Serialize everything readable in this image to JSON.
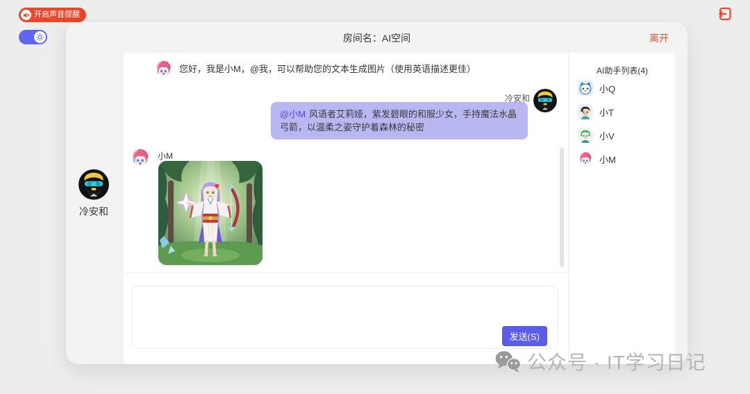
{
  "page": {
    "sound_alert_label": "开启声音提醒",
    "watermark_text": "公众号 · IT学习日记"
  },
  "header": {
    "room_label": "房间名：AI空间",
    "leave_label": "离开"
  },
  "chat": {
    "greeting": {
      "sender": "小M",
      "text": "您好，我是小M，@我，可以帮助您的文本生成图片（使用英语描述更佳）"
    },
    "user_message": {
      "sender": "冷安和",
      "mention": "@小M",
      "text": "风语者艾莉娅，紫发碧眼的和服少女，手持魔法水晶弓箭，以温柔之姿守护着森林的秘密"
    },
    "image_message": {
      "sender": "小M"
    }
  },
  "composer": {
    "input_value": "",
    "input_placeholder": "",
    "send_label": "发送(S)"
  },
  "user_panel": {
    "name": "冷安和"
  },
  "assistant_list": {
    "title": "AI助手列表(4)",
    "items": [
      {
        "name": "小Q"
      },
      {
        "name": "小T"
      },
      {
        "name": "小V"
      },
      {
        "name": "小M"
      }
    ]
  },
  "colors": {
    "accent_red": "#e8472c",
    "leave_red": "#e0512e",
    "bubble_purple": "#b9b7f2",
    "mention_blue": "#4a4cdb",
    "send_blue": "#5a5cea",
    "toggle_blue": "#6165ef",
    "watermark_gray": "#b5b5b7"
  }
}
